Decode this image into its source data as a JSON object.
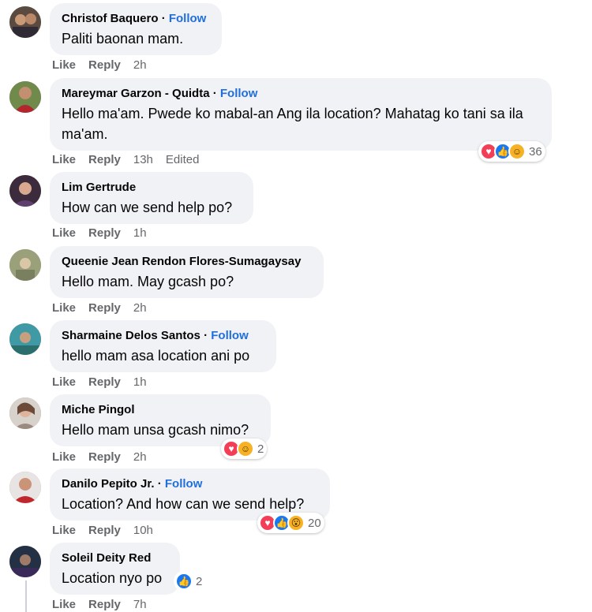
{
  "comments": [
    {
      "name": "Christof Baquero",
      "sep": "·",
      "follow": "Follow",
      "text": "Paliti baonan mam.",
      "like": "Like",
      "reply": "Reply",
      "time": "2h",
      "edited": "",
      "reactions_count": ""
    },
    {
      "name": "Mareymar Garzon - Quidta",
      "sep": "·",
      "follow": "Follow",
      "text": "Hello ma'am. Pwede ko mabal-an Ang ila location? Mahatag ko tani sa ila ma'am.",
      "like": "Like",
      "reply": "Reply",
      "time": "13h",
      "edited": "Edited",
      "reactions_count": "36"
    },
    {
      "name": "Lim Gertrude",
      "sep": "",
      "follow": "",
      "text": "How can we send help po?",
      "like": "Like",
      "reply": "Reply",
      "time": "1h",
      "edited": "",
      "reactions_count": ""
    },
    {
      "name": "Queenie Jean Rendon Flores-Sumagaysay",
      "sep": "",
      "follow": "",
      "text": "Hello mam. May gcash po?",
      "like": "Like",
      "reply": "Reply",
      "time": "2h",
      "edited": "",
      "reactions_count": ""
    },
    {
      "name": "Sharmaine Delos Santos",
      "sep": "·",
      "follow": "Follow",
      "text": "hello mam asa location ani po",
      "like": "Like",
      "reply": "Reply",
      "time": "1h",
      "edited": "",
      "reactions_count": ""
    },
    {
      "name": "Miche Pingol",
      "sep": "",
      "follow": "",
      "text": "Hello mam unsa gcash nimo?",
      "like": "Like",
      "reply": "Reply",
      "time": "2h",
      "edited": "",
      "reactions_count": "2"
    },
    {
      "name": "Danilo Pepito Jr.",
      "sep": "·",
      "follow": "Follow",
      "text": "Location? And how can we send help?",
      "like": "Like",
      "reply": "Reply",
      "time": "10h",
      "edited": "",
      "reactions_count": "20"
    },
    {
      "name": "Soleil Deity Red",
      "sep": "",
      "follow": "",
      "text": "Location nyo po",
      "like": "Like",
      "reply": "Reply",
      "time": "7h",
      "edited": "",
      "reactions_count": "2"
    }
  ],
  "colors": {
    "bubble": "#f0f2f5",
    "follow": "#216fdb",
    "meta": "#65676b",
    "heart": "#f33e58",
    "like": "#1877f2",
    "wow": "#f7b125"
  }
}
